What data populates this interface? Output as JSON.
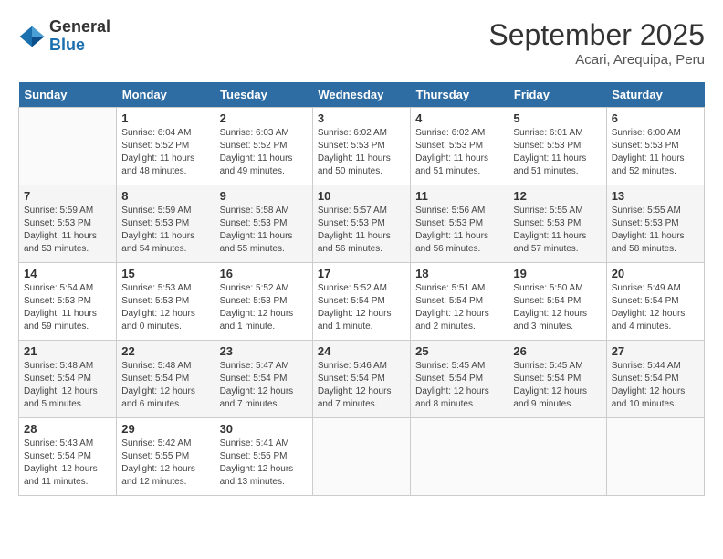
{
  "header": {
    "logo_line1": "General",
    "logo_line2": "Blue",
    "month": "September 2025",
    "location": "Acari, Arequipa, Peru"
  },
  "weekdays": [
    "Sunday",
    "Monday",
    "Tuesday",
    "Wednesday",
    "Thursday",
    "Friday",
    "Saturday"
  ],
  "weeks": [
    [
      {
        "day": null
      },
      {
        "day": 1,
        "sunrise": "6:04 AM",
        "sunset": "5:52 PM",
        "daylight": "11 hours and 48 minutes."
      },
      {
        "day": 2,
        "sunrise": "6:03 AM",
        "sunset": "5:52 PM",
        "daylight": "11 hours and 49 minutes."
      },
      {
        "day": 3,
        "sunrise": "6:02 AM",
        "sunset": "5:53 PM",
        "daylight": "11 hours and 50 minutes."
      },
      {
        "day": 4,
        "sunrise": "6:02 AM",
        "sunset": "5:53 PM",
        "daylight": "11 hours and 51 minutes."
      },
      {
        "day": 5,
        "sunrise": "6:01 AM",
        "sunset": "5:53 PM",
        "daylight": "11 hours and 51 minutes."
      },
      {
        "day": 6,
        "sunrise": "6:00 AM",
        "sunset": "5:53 PM",
        "daylight": "11 hours and 52 minutes."
      }
    ],
    [
      {
        "day": 7,
        "sunrise": "5:59 AM",
        "sunset": "5:53 PM",
        "daylight": "11 hours and 53 minutes."
      },
      {
        "day": 8,
        "sunrise": "5:59 AM",
        "sunset": "5:53 PM",
        "daylight": "11 hours and 54 minutes."
      },
      {
        "day": 9,
        "sunrise": "5:58 AM",
        "sunset": "5:53 PM",
        "daylight": "11 hours and 55 minutes."
      },
      {
        "day": 10,
        "sunrise": "5:57 AM",
        "sunset": "5:53 PM",
        "daylight": "11 hours and 56 minutes."
      },
      {
        "day": 11,
        "sunrise": "5:56 AM",
        "sunset": "5:53 PM",
        "daylight": "11 hours and 56 minutes."
      },
      {
        "day": 12,
        "sunrise": "5:55 AM",
        "sunset": "5:53 PM",
        "daylight": "11 hours and 57 minutes."
      },
      {
        "day": 13,
        "sunrise": "5:55 AM",
        "sunset": "5:53 PM",
        "daylight": "11 hours and 58 minutes."
      }
    ],
    [
      {
        "day": 14,
        "sunrise": "5:54 AM",
        "sunset": "5:53 PM",
        "daylight": "11 hours and 59 minutes."
      },
      {
        "day": 15,
        "sunrise": "5:53 AM",
        "sunset": "5:53 PM",
        "daylight": "12 hours and 0 minutes."
      },
      {
        "day": 16,
        "sunrise": "5:52 AM",
        "sunset": "5:53 PM",
        "daylight": "12 hours and 1 minute."
      },
      {
        "day": 17,
        "sunrise": "5:52 AM",
        "sunset": "5:54 PM",
        "daylight": "12 hours and 1 minute."
      },
      {
        "day": 18,
        "sunrise": "5:51 AM",
        "sunset": "5:54 PM",
        "daylight": "12 hours and 2 minutes."
      },
      {
        "day": 19,
        "sunrise": "5:50 AM",
        "sunset": "5:54 PM",
        "daylight": "12 hours and 3 minutes."
      },
      {
        "day": 20,
        "sunrise": "5:49 AM",
        "sunset": "5:54 PM",
        "daylight": "12 hours and 4 minutes."
      }
    ],
    [
      {
        "day": 21,
        "sunrise": "5:48 AM",
        "sunset": "5:54 PM",
        "daylight": "12 hours and 5 minutes."
      },
      {
        "day": 22,
        "sunrise": "5:48 AM",
        "sunset": "5:54 PM",
        "daylight": "12 hours and 6 minutes."
      },
      {
        "day": 23,
        "sunrise": "5:47 AM",
        "sunset": "5:54 PM",
        "daylight": "12 hours and 7 minutes."
      },
      {
        "day": 24,
        "sunrise": "5:46 AM",
        "sunset": "5:54 PM",
        "daylight": "12 hours and 7 minutes."
      },
      {
        "day": 25,
        "sunrise": "5:45 AM",
        "sunset": "5:54 PM",
        "daylight": "12 hours and 8 minutes."
      },
      {
        "day": 26,
        "sunrise": "5:45 AM",
        "sunset": "5:54 PM",
        "daylight": "12 hours and 9 minutes."
      },
      {
        "day": 27,
        "sunrise": "5:44 AM",
        "sunset": "5:54 PM",
        "daylight": "12 hours and 10 minutes."
      }
    ],
    [
      {
        "day": 28,
        "sunrise": "5:43 AM",
        "sunset": "5:54 PM",
        "daylight": "12 hours and 11 minutes."
      },
      {
        "day": 29,
        "sunrise": "5:42 AM",
        "sunset": "5:55 PM",
        "daylight": "12 hours and 12 minutes."
      },
      {
        "day": 30,
        "sunrise": "5:41 AM",
        "sunset": "5:55 PM",
        "daylight": "12 hours and 13 minutes."
      },
      {
        "day": null
      },
      {
        "day": null
      },
      {
        "day": null
      },
      {
        "day": null
      }
    ]
  ],
  "labels": {
    "sunrise": "Sunrise:",
    "sunset": "Sunset:",
    "daylight": "Daylight:"
  }
}
